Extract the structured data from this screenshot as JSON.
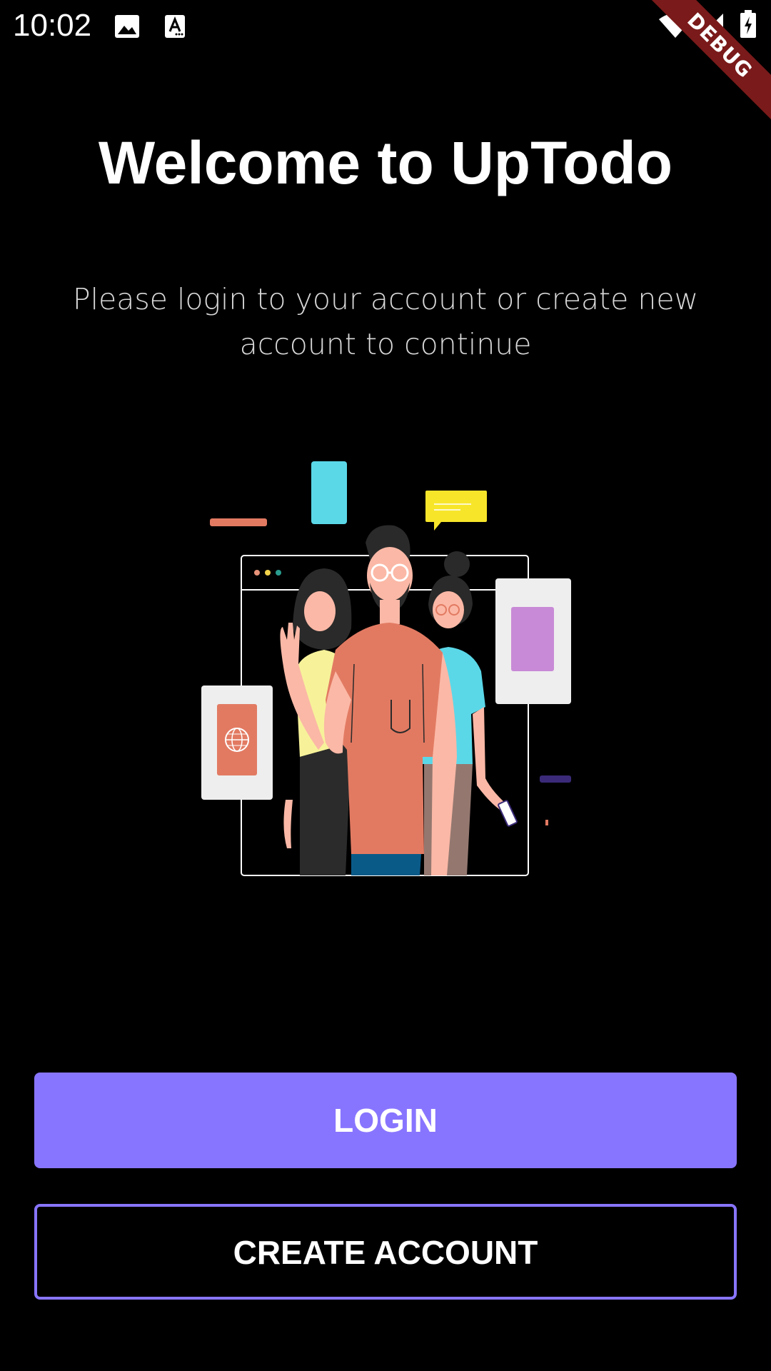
{
  "status_bar": {
    "time": "10:02",
    "left_icons": [
      "image-icon",
      "text-accessibility-icon"
    ],
    "right_icons": [
      "wifi-icon",
      "cell-signal-icon",
      "battery-charging-icon"
    ],
    "debug_label": "DEBUG"
  },
  "welcome": {
    "title": "Welcome to UpTodo",
    "subtitle": "Please login to your account or create new account to continue"
  },
  "illustration": {
    "icon": "team-illustration-icon"
  },
  "actions": {
    "login_label": "LOGIN",
    "create_account_label": "CREATE ACCOUNT"
  },
  "colors": {
    "background": "#000000",
    "accent": "#8875FF",
    "text": "#FFFFFF",
    "debug_banner": "#7A1A1A"
  }
}
